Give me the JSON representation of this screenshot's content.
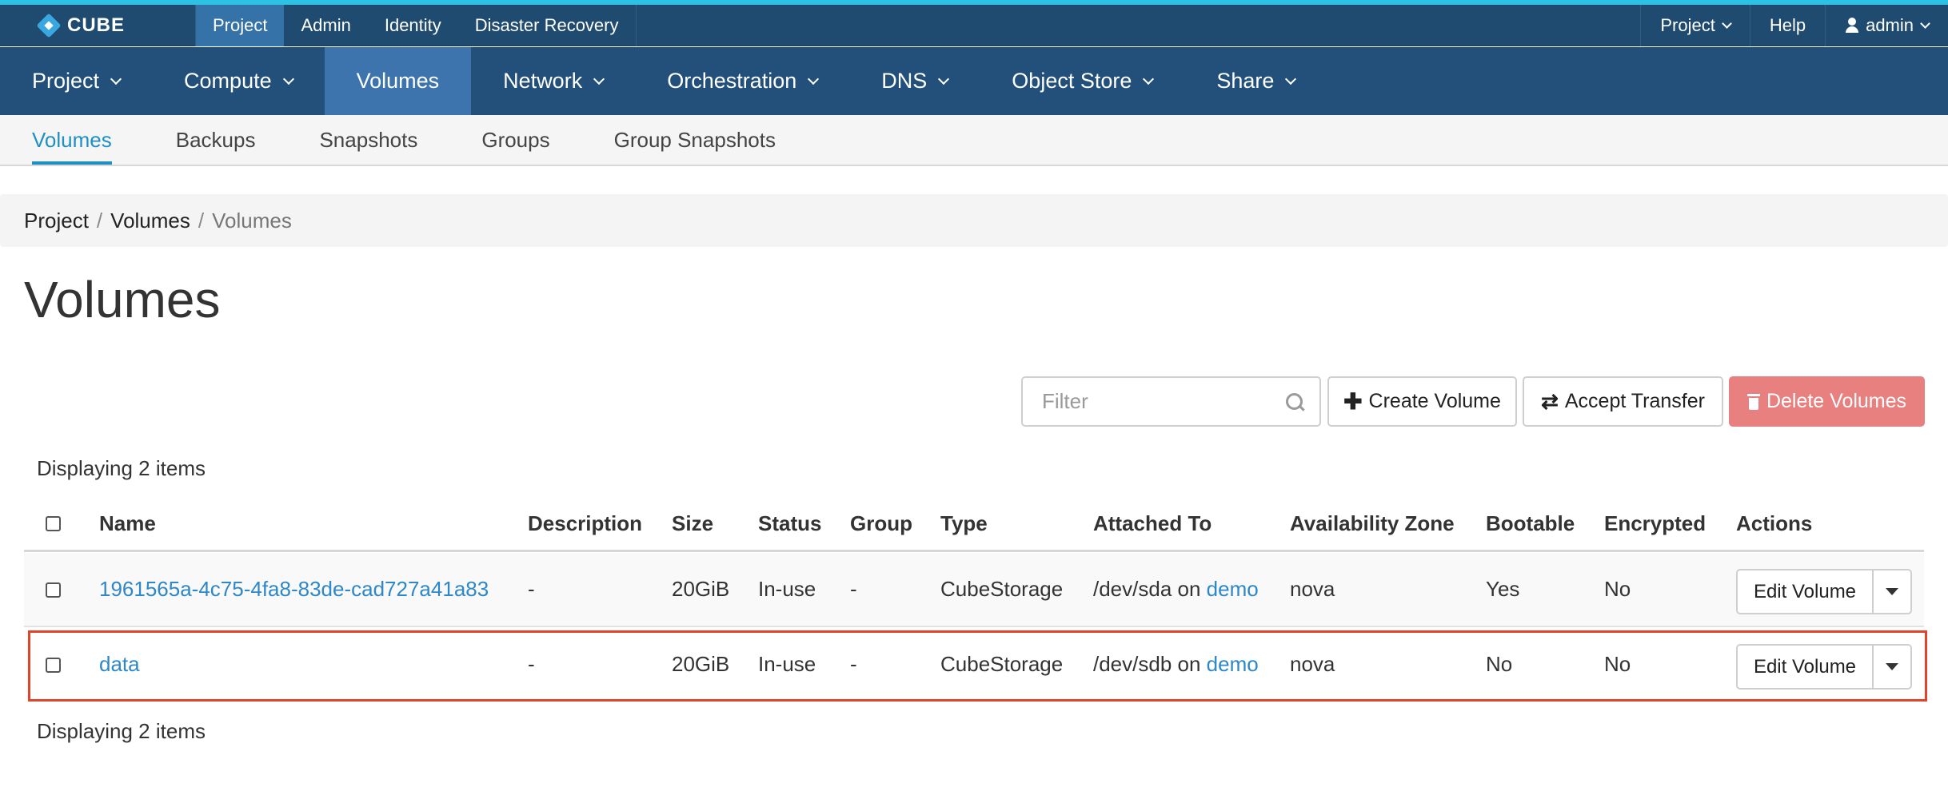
{
  "brand": {
    "logo_text": "CUBE"
  },
  "top_nav": {
    "left_items": [
      "Project",
      "Admin",
      "Identity",
      "Disaster Recovery"
    ],
    "active": "Project",
    "project_menu": "Project",
    "help": "Help",
    "user": "admin"
  },
  "main_nav": {
    "items": [
      "Project",
      "Compute",
      "Volumes",
      "Network",
      "Orchestration",
      "DNS",
      "Object Store",
      "Share"
    ],
    "active": "Volumes"
  },
  "sub_nav": {
    "items": [
      "Volumes",
      "Backups",
      "Snapshots",
      "Groups",
      "Group Snapshots"
    ],
    "active": "Volumes"
  },
  "breadcrumb": {
    "items": [
      "Project",
      "Volumes"
    ],
    "current": "Volumes"
  },
  "page_title": "Volumes",
  "toolbar": {
    "filter_placeholder": "Filter",
    "create_label": "Create Volume",
    "accept_label": "Accept Transfer",
    "delete_label": "Delete Volumes",
    "delete_color": "#e8807f"
  },
  "table": {
    "displaying_top": "Displaying 2 items",
    "displaying_bottom": "Displaying 2 items",
    "columns": [
      "Name",
      "Description",
      "Size",
      "Status",
      "Group",
      "Type",
      "Attached To",
      "Availability Zone",
      "Bootable",
      "Encrypted",
      "Actions"
    ],
    "rows": [
      {
        "name": "1961565a-4c75-4fa8-83de-cad727a41a83",
        "description": "-",
        "size": "20GiB",
        "status": "In-use",
        "group": "-",
        "type": "CubeStorage",
        "attached_device": "/dev/sda on ",
        "attached_host": "demo",
        "zone": "nova",
        "bootable": "Yes",
        "encrypted": "No",
        "action": "Edit Volume"
      },
      {
        "name": "data",
        "description": "-",
        "size": "20GiB",
        "status": "In-use",
        "group": "-",
        "type": "CubeStorage",
        "attached_device": "/dev/sdb on ",
        "attached_host": "demo",
        "zone": "nova",
        "bootable": "No",
        "encrypted": "No",
        "action": "Edit Volume",
        "highlighted": true
      }
    ]
  },
  "colors": {
    "accent_stripe": "#2dc1e3",
    "topbar": "#1f4b70",
    "mainbar": "#22507a",
    "link": "#2d87c8",
    "highlight": "#e2432b"
  }
}
